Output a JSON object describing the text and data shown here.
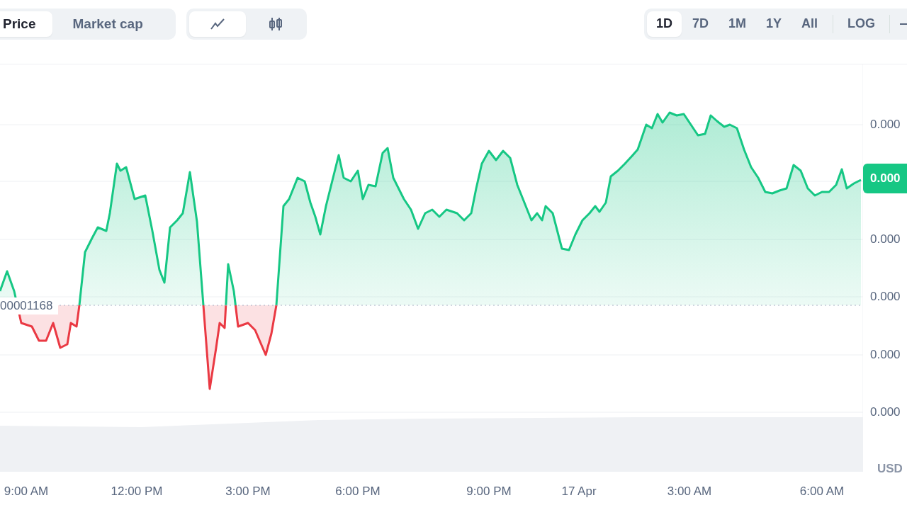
{
  "metric_tabs": [
    {
      "label": "Price",
      "selected": true
    },
    {
      "label": "Market cap",
      "selected": false
    }
  ],
  "chart_types": [
    {
      "kind": "line",
      "selected": true
    },
    {
      "kind": "candles",
      "selected": false
    }
  ],
  "ranges": [
    {
      "label": "1D",
      "selected": true
    },
    {
      "label": "7D",
      "selected": false
    },
    {
      "label": "1M",
      "selected": false
    },
    {
      "label": "1Y",
      "selected": false
    },
    {
      "label": "All",
      "selected": false
    }
  ],
  "scale_button": {
    "label": "LOG"
  },
  "chart": {
    "y_labels": [
      "0.000",
      "0.000",
      "0.000",
      "0.000",
      "0.000"
    ],
    "current_price": "0.000",
    "baseline_price": "00001168",
    "currency": "USD",
    "x_labels": [
      "9:00 AM",
      "12:00 PM",
      "3:00 PM",
      "6:00 PM",
      "9:00 PM",
      "17 Apr",
      "3:00 AM",
      "6:00 AM"
    ]
  }
}
